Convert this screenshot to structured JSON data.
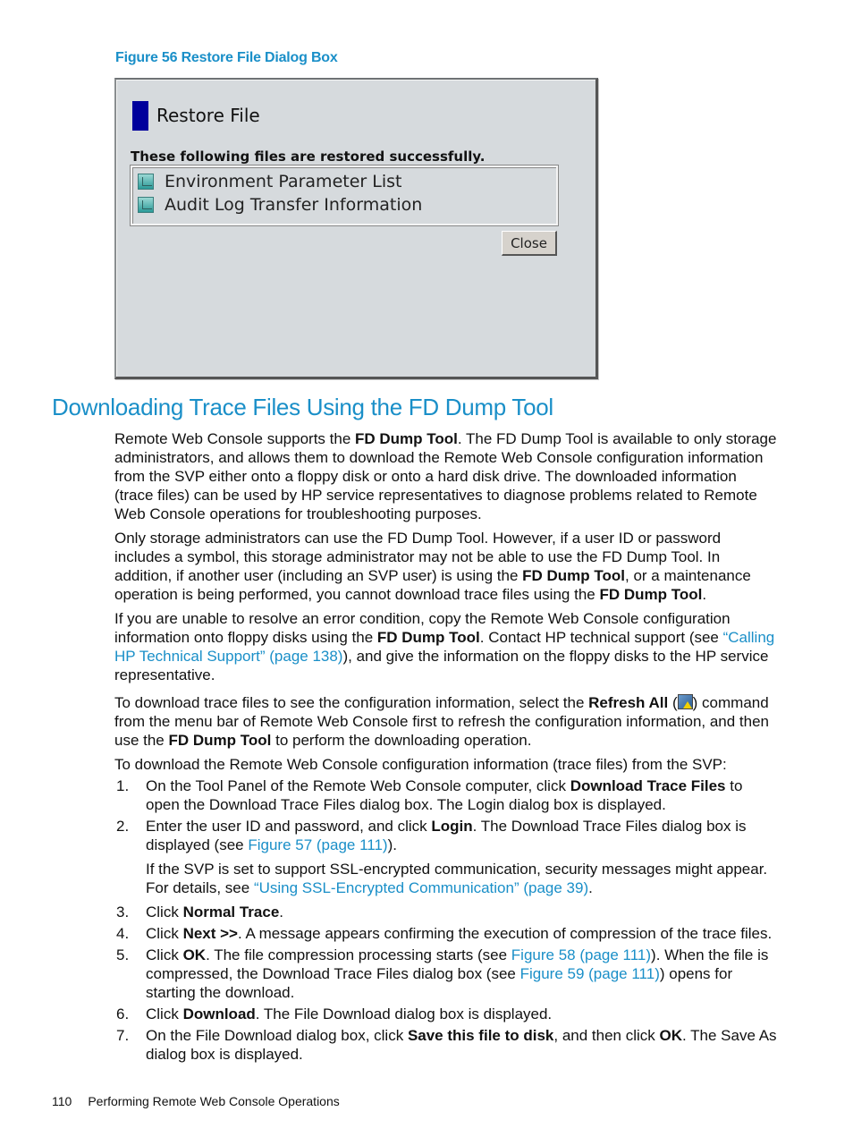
{
  "figure": {
    "caption": "Figure 56 Restore File Dialog Box",
    "dialog": {
      "title": "Restore File",
      "message": "These following files are restored successfully.",
      "files": [
        {
          "icon": "file-icon",
          "label": "Environment Parameter List"
        },
        {
          "icon": "file-icon",
          "label": "Audit Log Transfer Information"
        }
      ],
      "close_label": "Close"
    }
  },
  "section": {
    "title": "Downloading Trace Files Using the FD Dump Tool",
    "p1": {
      "a": "Remote Web Console supports the ",
      "b1": "FD Dump Tool",
      "c": ". The FD Dump Tool is available to only storage administrators, and allows them to download the Remote Web Console configuration information from the SVP either onto a floppy disk or onto a hard disk drive. The downloaded information (trace files) can be used by HP service representatives to diagnose problems related to Remote Web Console operations for troubleshooting purposes."
    },
    "p2": {
      "a": "Only storage administrators can use the FD Dump Tool. However, if a user ID or password includes a symbol, this storage administrator may not be able to use the FD Dump Tool. In addition, if another user (including an SVP user) is using the ",
      "b1": "FD Dump Tool",
      "c": ", or a maintenance operation is being performed, you cannot download trace files using the ",
      "b2": "FD Dump Tool",
      "d": "."
    },
    "p3": {
      "a": "If you are unable to resolve an error condition, copy the Remote Web Console configuration information onto floppy disks using the ",
      "b1": "FD Dump Tool",
      "c": ". Contact HP technical support (see ",
      "link": "“Calling HP Technical Support” (page 138)",
      "d": "), and give the information on the floppy disks to the HP service representative."
    },
    "p4": {
      "a": "To download trace files to see the configuration information, select the ",
      "b1": "Refresh All",
      "icon": "refresh-all-icon",
      "c": " command from the menu bar of Remote Web Console first to refresh the configuration information, and then use the ",
      "b2": "FD Dump Tool",
      "d": " to perform the downloading operation."
    },
    "p5": "To download the Remote Web Console configuration information (trace files) from the SVP:",
    "steps": [
      {
        "num": "1.",
        "a": "On the Tool Panel of the Remote Web Console computer, click ",
        "b": "Download Trace Files",
        "c": " to open the Download Trace Files dialog box. The Login dialog box is displayed."
      },
      {
        "num": "2.",
        "a": "Enter the user ID and password, and click ",
        "b": "Login",
        "c": ". The Download Trace Files dialog box is displayed (see ",
        "link": "Figure 57 (page 111)",
        "d": ").",
        "sub": {
          "a": "If the SVP is set to support SSL-encrypted communication, security messages might appear. For details, see ",
          "link": "“Using SSL-Encrypted Communication” (page 39)",
          "b": "."
        }
      },
      {
        "num": "3.",
        "a": "Click ",
        "b": "Normal Trace",
        "c": "."
      },
      {
        "num": "4.",
        "a": "Click ",
        "b": "Next >>",
        "c": ". A message appears confirming the execution of compression of the trace files."
      },
      {
        "num": "5.",
        "a": "Click ",
        "b": "OK",
        "c": ". The file compression processing starts (see ",
        "link": "Figure 58 (page 111)",
        "d": "). When the file is compressed, the Download Trace Files dialog box (see ",
        "link2": "Figure 59 (page 111)",
        "e": ") opens for starting the download."
      },
      {
        "num": "6.",
        "a": "Click ",
        "b": "Download",
        "c": ". The File Download dialog box is displayed."
      },
      {
        "num": "7.",
        "a": "On the File Download dialog box, click ",
        "b": "Save this file to disk",
        "c": ", and then click ",
        "b2": "OK",
        "d": ". The Save As dialog box is displayed."
      }
    ]
  },
  "footer": {
    "page_number": "110",
    "chapter": "Performing Remote Web Console Operations"
  },
  "colors": {
    "heading_blue": "#1a8fc8",
    "dialog_bg": "#d6dadd",
    "title_marker": "#00009c"
  }
}
